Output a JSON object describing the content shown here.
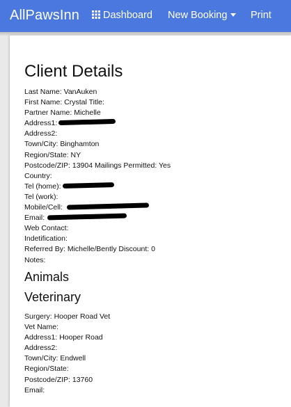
{
  "app": {
    "brand": "AllPawsInn"
  },
  "nav": {
    "dashboard": "Dashboard",
    "new_booking": "New Booking",
    "print": "Print"
  },
  "page": {
    "title": "Client Details"
  },
  "client": {
    "last_name": "Last Name: VanAuken",
    "first_name": "First Name: Crystal Title:",
    "partner_name": "Partner Name: Michelle",
    "address1": "Address1:",
    "address2": "Address2:",
    "town": "Town/City: Binghamton",
    "region": "Region/State: NY",
    "postcode": "Postcode/ZIP: 13904 Mailings Permitted: Yes",
    "country": "Country:",
    "tel_home": "Tel (home):",
    "tel_work": "Tel (work):",
    "mobile": "Mobile/Cell:",
    "email": "Email:",
    "web_contact": "Web Contact:",
    "identification": "Indetification:",
    "referred_by": "Referred By: Michelle/Bently Discount: 0",
    "notes": "Notes:"
  },
  "sections": {
    "animals": "Animals",
    "veterinary": "Veterinary"
  },
  "vet": {
    "surgery": "Surgery: Hooper Road Vet",
    "vet_name": "Vet Name:",
    "address1": "Address1: Hooper Road",
    "address2": "Address2:",
    "town": "Town/City: Endwell",
    "region": "Region/State:",
    "postcode": "Postcode/ZIP: 13760",
    "email": "Email:"
  },
  "colors": {
    "navbar": "#4a78df",
    "background": "#e9e9e9",
    "panel": "#ffffff"
  },
  "icons": {
    "dashboard": "grid-icon",
    "new_booking": "caret-down-icon"
  }
}
